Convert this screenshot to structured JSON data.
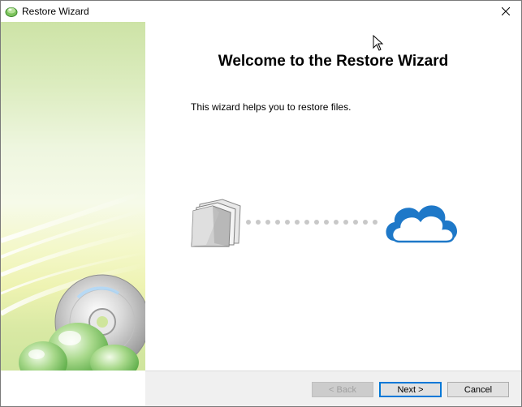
{
  "window": {
    "title": "Restore Wizard",
    "icon": "restore-wizard-app-icon",
    "close_icon": "close-icon"
  },
  "sidebar": {
    "graphic": "cd-disc-banner"
  },
  "content": {
    "heading": "Welcome to the Restore Wizard",
    "description": "This wizard helps you to restore files.",
    "illustration": {
      "source_icon": "files-stack-icon",
      "connector": "dotted-line",
      "target_icon": "cloud-icon",
      "accent_color": "#1e78c8"
    }
  },
  "buttons": {
    "back": {
      "label": "< Back",
      "enabled": false
    },
    "next": {
      "label": "Next >",
      "enabled": true,
      "default": true
    },
    "cancel": {
      "label": "Cancel",
      "enabled": true
    }
  }
}
